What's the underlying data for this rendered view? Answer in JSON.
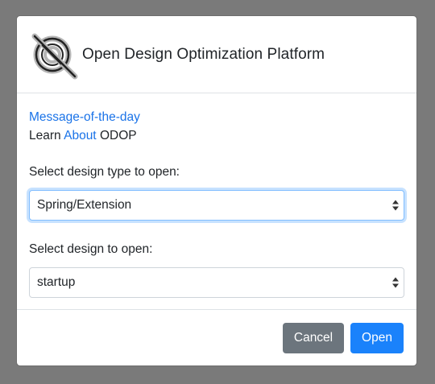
{
  "header": {
    "title": "Open Design Optimization Platform"
  },
  "body": {
    "motd_link": "Message-of-the-day",
    "learn_prefix": "Learn",
    "about_link": "About",
    "learn_suffix": "ODOP",
    "type_label": "Select design type to open:",
    "type_value": "Spring/Extension",
    "design_label": "Select design to open:",
    "design_value": "startup"
  },
  "footer": {
    "cancel_label": "Cancel",
    "open_label": "Open"
  },
  "colors": {
    "link": "#1a73e8",
    "primary": "#1a82fb",
    "secondary": "#6c757d",
    "backdrop": "#7a7a7a"
  }
}
